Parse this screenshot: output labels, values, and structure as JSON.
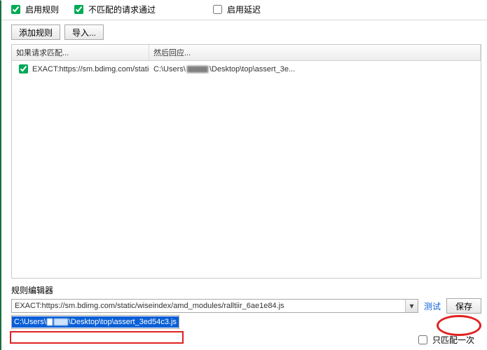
{
  "topbar": {
    "enable_rules": "启用规则",
    "enable_rules_checked": true,
    "pass_unmatched": "不匹配的请求通过",
    "pass_unmatched_checked": true,
    "enable_delay": "启用延迟",
    "enable_delay_checked": false
  },
  "buttons": {
    "add_rule": "添加规则",
    "import": "导入..."
  },
  "list": {
    "col_match": "如果请求匹配...",
    "col_respond": "然后回应...",
    "rows": [
      {
        "checked": true,
        "match": "EXACT:https://sm.bdimg.com/static/wiseind...",
        "respond_prefix": "C:\\Users\\",
        "respond_suffix": "\\Desktop\\top\\assert_3e..."
      }
    ]
  },
  "editor": {
    "label": "规则编辑器",
    "rule_url": "EXACT:https://sm.bdimg.com/static/wiseindex/amd_modules/ralltiir_6ae1e84.js",
    "test_link": "测试",
    "save": "保存",
    "path_seg1": "C:\\Users\\",
    "path_seg2": "\\Desktop\\top\\assert_3ed54c3.js"
  },
  "footer": {
    "match_once": "只匹配一次",
    "match_once_checked": false
  },
  "icons": {
    "chevron_down": "▾"
  }
}
